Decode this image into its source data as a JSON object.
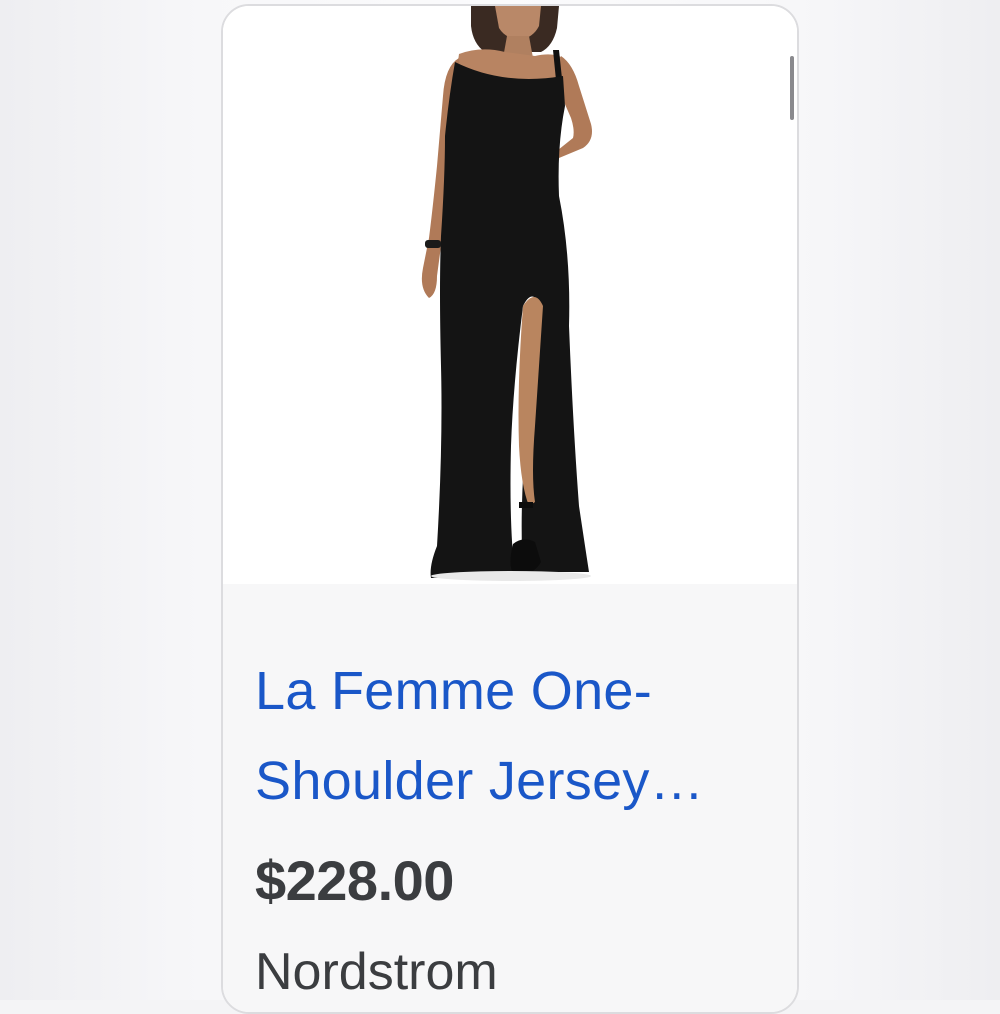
{
  "product": {
    "title_line1": "La Femme One-",
    "title_line2": "Shoulder Jersey…",
    "price": "$228.00",
    "store": "Nordstrom",
    "image_icon": "dress-photo",
    "link_color": "#1a57c8"
  }
}
